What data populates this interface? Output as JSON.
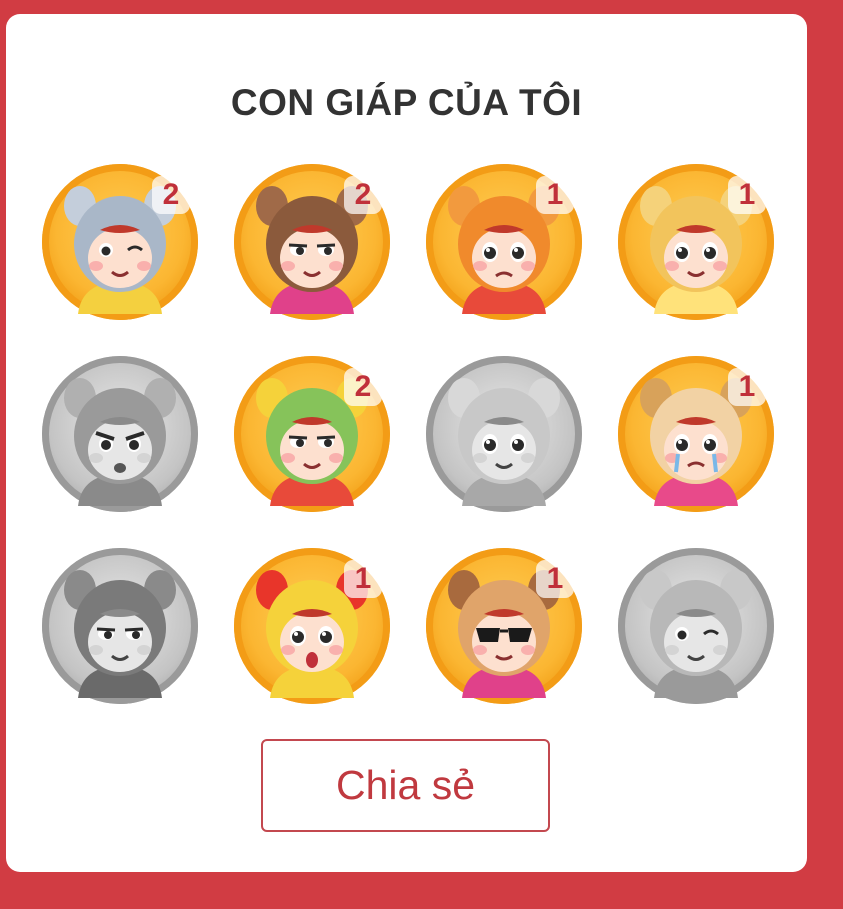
{
  "title": "CON GIÁP CỦA TÔI",
  "zodiacs": [
    {
      "animal": "rat",
      "unlocked": true,
      "count": "2",
      "hood_color": "#a9b7c8",
      "ear_color": "#c4cedb",
      "outfit_color": "#f4d03f",
      "expression": "wink"
    },
    {
      "animal": "ox",
      "unlocked": true,
      "count": "2",
      "hood_color": "#8b5a3c",
      "ear_color": "#a06a48",
      "outfit_color": "#e0418a",
      "expression": "smirk"
    },
    {
      "animal": "tiger",
      "unlocked": true,
      "count": "1",
      "hood_color": "#f08a2c",
      "ear_color": "#f29a3e",
      "outfit_color": "#e84a3a",
      "expression": "sad"
    },
    {
      "animal": "cat",
      "unlocked": true,
      "count": "1",
      "hood_color": "#f2c45c",
      "ear_color": "#f5d27a",
      "outfit_color": "#ffe27a",
      "expression": "happy"
    },
    {
      "animal": "dragon",
      "unlocked": false,
      "count": "",
      "hood_color": "#9a9a9a",
      "ear_color": "#b0b0b0",
      "outfit_color": "#8a8a8a",
      "expression": "angry"
    },
    {
      "animal": "snake",
      "unlocked": true,
      "count": "2",
      "hood_color": "#86c35a",
      "ear_color": "#f5d23a",
      "outfit_color": "#e84a3a",
      "expression": "smirk"
    },
    {
      "animal": "horse",
      "unlocked": false,
      "count": "",
      "hood_color": "#c8c8c8",
      "ear_color": "#d8d8d8",
      "outfit_color": "#a8a8a8",
      "expression": "happy"
    },
    {
      "animal": "goat",
      "unlocked": true,
      "count": "1",
      "hood_color": "#f2d2a4",
      "ear_color": "#d8a25a",
      "outfit_color": "#e84a8a",
      "expression": "cry"
    },
    {
      "animal": "monkey",
      "unlocked": false,
      "count": "",
      "hood_color": "#7a7a7a",
      "ear_color": "#8a8a8a",
      "outfit_color": "#6a6a6a",
      "expression": "smirk"
    },
    {
      "animal": "rooster",
      "unlocked": true,
      "count": "1",
      "hood_color": "#f5d23a",
      "ear_color": "#e8352a",
      "outfit_color": "#f5d23a",
      "expression": "surprised"
    },
    {
      "animal": "dog",
      "unlocked": true,
      "count": "1",
      "hood_color": "#e0a46a",
      "ear_color": "#a86a3e",
      "outfit_color": "#e0418a",
      "expression": "cool"
    },
    {
      "animal": "pig",
      "unlocked": false,
      "count": "",
      "hood_color": "#b8b8b8",
      "ear_color": "#c8c8c8",
      "outfit_color": "#9a9a9a",
      "expression": "wink"
    }
  ],
  "share_label": "Chia sẻ",
  "colors": {
    "background": "#d13c43",
    "card": "#ffffff",
    "title": "#333333",
    "badge_text": "#c0303a",
    "button_border": "#c3484f",
    "coin_gold": "#fbb632",
    "coin_silver": "#c4c4c4"
  }
}
